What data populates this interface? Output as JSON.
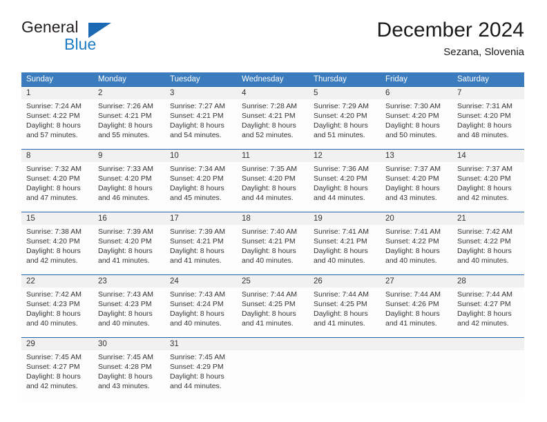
{
  "brand": {
    "name_part1": "General",
    "name_part2": "Blue",
    "triangle_color": "#1b69b2",
    "blue_color": "#1b7cc4"
  },
  "header": {
    "title": "December 2024",
    "subtitle": "Sezana, Slovenia"
  },
  "theme": {
    "header_bg": "#3b7cbf",
    "week_rule": "#1f63a8",
    "daynum_bg": "#f1f1f1"
  },
  "weekdays": [
    "Sunday",
    "Monday",
    "Tuesday",
    "Wednesday",
    "Thursday",
    "Friday",
    "Saturday"
  ],
  "weeks": [
    {
      "days": [
        {
          "num": "1",
          "l1": "Sunrise: 7:24 AM",
          "l2": "Sunset: 4:22 PM",
          "l3": "Daylight: 8 hours",
          "l4": "and 57 minutes."
        },
        {
          "num": "2",
          "l1": "Sunrise: 7:26 AM",
          "l2": "Sunset: 4:21 PM",
          "l3": "Daylight: 8 hours",
          "l4": "and 55 minutes."
        },
        {
          "num": "3",
          "l1": "Sunrise: 7:27 AM",
          "l2": "Sunset: 4:21 PM",
          "l3": "Daylight: 8 hours",
          "l4": "and 54 minutes."
        },
        {
          "num": "4",
          "l1": "Sunrise: 7:28 AM",
          "l2": "Sunset: 4:21 PM",
          "l3": "Daylight: 8 hours",
          "l4": "and 52 minutes."
        },
        {
          "num": "5",
          "l1": "Sunrise: 7:29 AM",
          "l2": "Sunset: 4:20 PM",
          "l3": "Daylight: 8 hours",
          "l4": "and 51 minutes."
        },
        {
          "num": "6",
          "l1": "Sunrise: 7:30 AM",
          "l2": "Sunset: 4:20 PM",
          "l3": "Daylight: 8 hours",
          "l4": "and 50 minutes."
        },
        {
          "num": "7",
          "l1": "Sunrise: 7:31 AM",
          "l2": "Sunset: 4:20 PM",
          "l3": "Daylight: 8 hours",
          "l4": "and 48 minutes."
        }
      ]
    },
    {
      "days": [
        {
          "num": "8",
          "l1": "Sunrise: 7:32 AM",
          "l2": "Sunset: 4:20 PM",
          "l3": "Daylight: 8 hours",
          "l4": "and 47 minutes."
        },
        {
          "num": "9",
          "l1": "Sunrise: 7:33 AM",
          "l2": "Sunset: 4:20 PM",
          "l3": "Daylight: 8 hours",
          "l4": "and 46 minutes."
        },
        {
          "num": "10",
          "l1": "Sunrise: 7:34 AM",
          "l2": "Sunset: 4:20 PM",
          "l3": "Daylight: 8 hours",
          "l4": "and 45 minutes."
        },
        {
          "num": "11",
          "l1": "Sunrise: 7:35 AM",
          "l2": "Sunset: 4:20 PM",
          "l3": "Daylight: 8 hours",
          "l4": "and 44 minutes."
        },
        {
          "num": "12",
          "l1": "Sunrise: 7:36 AM",
          "l2": "Sunset: 4:20 PM",
          "l3": "Daylight: 8 hours",
          "l4": "and 44 minutes."
        },
        {
          "num": "13",
          "l1": "Sunrise: 7:37 AM",
          "l2": "Sunset: 4:20 PM",
          "l3": "Daylight: 8 hours",
          "l4": "and 43 minutes."
        },
        {
          "num": "14",
          "l1": "Sunrise: 7:37 AM",
          "l2": "Sunset: 4:20 PM",
          "l3": "Daylight: 8 hours",
          "l4": "and 42 minutes."
        }
      ]
    },
    {
      "days": [
        {
          "num": "15",
          "l1": "Sunrise: 7:38 AM",
          "l2": "Sunset: 4:20 PM",
          "l3": "Daylight: 8 hours",
          "l4": "and 42 minutes."
        },
        {
          "num": "16",
          "l1": "Sunrise: 7:39 AM",
          "l2": "Sunset: 4:20 PM",
          "l3": "Daylight: 8 hours",
          "l4": "and 41 minutes."
        },
        {
          "num": "17",
          "l1": "Sunrise: 7:39 AM",
          "l2": "Sunset: 4:21 PM",
          "l3": "Daylight: 8 hours",
          "l4": "and 41 minutes."
        },
        {
          "num": "18",
          "l1": "Sunrise: 7:40 AM",
          "l2": "Sunset: 4:21 PM",
          "l3": "Daylight: 8 hours",
          "l4": "and 40 minutes."
        },
        {
          "num": "19",
          "l1": "Sunrise: 7:41 AM",
          "l2": "Sunset: 4:21 PM",
          "l3": "Daylight: 8 hours",
          "l4": "and 40 minutes."
        },
        {
          "num": "20",
          "l1": "Sunrise: 7:41 AM",
          "l2": "Sunset: 4:22 PM",
          "l3": "Daylight: 8 hours",
          "l4": "and 40 minutes."
        },
        {
          "num": "21",
          "l1": "Sunrise: 7:42 AM",
          "l2": "Sunset: 4:22 PM",
          "l3": "Daylight: 8 hours",
          "l4": "and 40 minutes."
        }
      ]
    },
    {
      "days": [
        {
          "num": "22",
          "l1": "Sunrise: 7:42 AM",
          "l2": "Sunset: 4:23 PM",
          "l3": "Daylight: 8 hours",
          "l4": "and 40 minutes."
        },
        {
          "num": "23",
          "l1": "Sunrise: 7:43 AM",
          "l2": "Sunset: 4:23 PM",
          "l3": "Daylight: 8 hours",
          "l4": "and 40 minutes."
        },
        {
          "num": "24",
          "l1": "Sunrise: 7:43 AM",
          "l2": "Sunset: 4:24 PM",
          "l3": "Daylight: 8 hours",
          "l4": "and 40 minutes."
        },
        {
          "num": "25",
          "l1": "Sunrise: 7:44 AM",
          "l2": "Sunset: 4:25 PM",
          "l3": "Daylight: 8 hours",
          "l4": "and 41 minutes."
        },
        {
          "num": "26",
          "l1": "Sunrise: 7:44 AM",
          "l2": "Sunset: 4:25 PM",
          "l3": "Daylight: 8 hours",
          "l4": "and 41 minutes."
        },
        {
          "num": "27",
          "l1": "Sunrise: 7:44 AM",
          "l2": "Sunset: 4:26 PM",
          "l3": "Daylight: 8 hours",
          "l4": "and 41 minutes."
        },
        {
          "num": "28",
          "l1": "Sunrise: 7:44 AM",
          "l2": "Sunset: 4:27 PM",
          "l3": "Daylight: 8 hours",
          "l4": "and 42 minutes."
        }
      ]
    },
    {
      "days": [
        {
          "num": "29",
          "l1": "Sunrise: 7:45 AM",
          "l2": "Sunset: 4:27 PM",
          "l3": "Daylight: 8 hours",
          "l4": "and 42 minutes."
        },
        {
          "num": "30",
          "l1": "Sunrise: 7:45 AM",
          "l2": "Sunset: 4:28 PM",
          "l3": "Daylight: 8 hours",
          "l4": "and 43 minutes."
        },
        {
          "num": "31",
          "l1": "Sunrise: 7:45 AM",
          "l2": "Sunset: 4:29 PM",
          "l3": "Daylight: 8 hours",
          "l4": "and 44 minutes."
        },
        {
          "num": "",
          "l1": "",
          "l2": "",
          "l3": "",
          "l4": ""
        },
        {
          "num": "",
          "l1": "",
          "l2": "",
          "l3": "",
          "l4": ""
        },
        {
          "num": "",
          "l1": "",
          "l2": "",
          "l3": "",
          "l4": ""
        },
        {
          "num": "",
          "l1": "",
          "l2": "",
          "l3": "",
          "l4": ""
        }
      ]
    }
  ]
}
